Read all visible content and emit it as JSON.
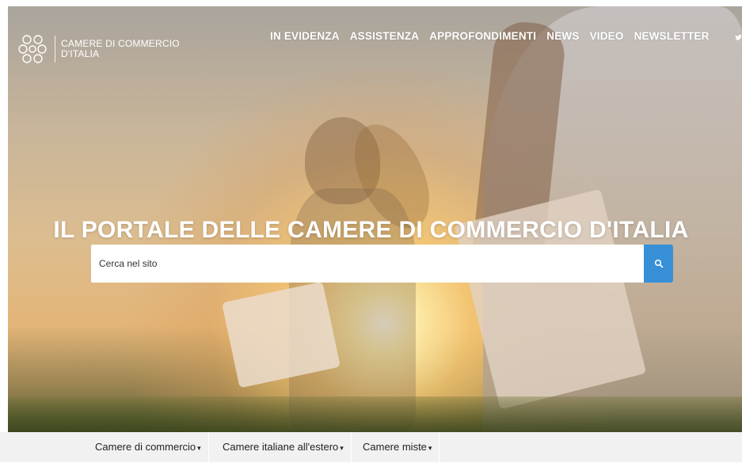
{
  "brand": {
    "name_line1": "CAMERE DI COMMERCIO",
    "name_line2": "D'ITALIA"
  },
  "nav": {
    "items": [
      {
        "label": "IN EVIDENZA"
      },
      {
        "label": "ASSISTENZA"
      },
      {
        "label": "APPROFONDIMENTI"
      },
      {
        "label": "NEWS"
      },
      {
        "label": "VIDEO"
      },
      {
        "label": "NEWSLETTER"
      }
    ],
    "social_icon": "twitter-icon"
  },
  "hero": {
    "headline": "IL PORTALE DELLE CAMERE DI COMMERCIO D'ITALIA"
  },
  "search": {
    "placeholder": "Cerca nel sito",
    "value": "",
    "icon": "search-icon",
    "button_color": "#3790d7"
  },
  "bottom_tabs": [
    {
      "label": "Camere di commercio",
      "caret": "▾"
    },
    {
      "label": "Camere italiane all'estero",
      "caret": "▾"
    },
    {
      "label": "Camere miste",
      "caret": "▾"
    }
  ],
  "colors": {
    "accent": "#3790d7",
    "bottom_bar": "#f1f1f1",
    "nav_text": "#ffffff"
  }
}
